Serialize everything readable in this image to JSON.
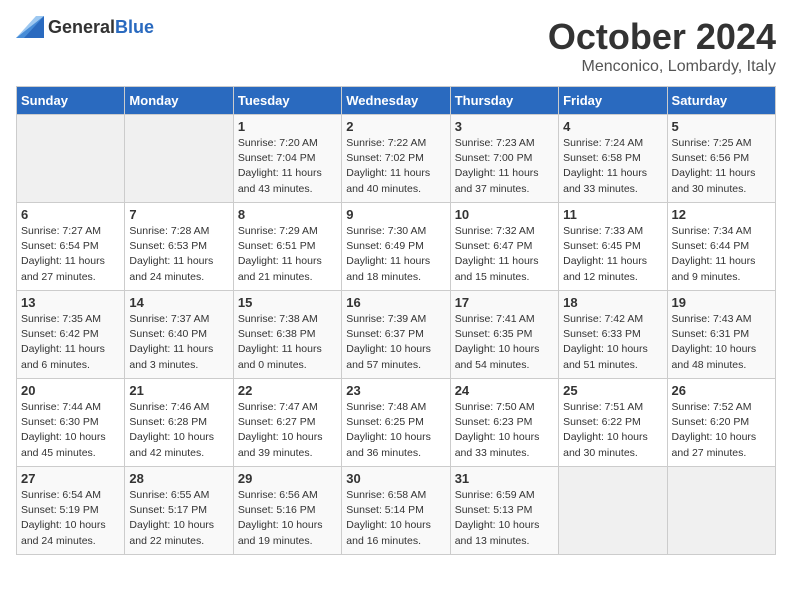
{
  "logo": {
    "general": "General",
    "blue": "Blue"
  },
  "title": "October 2024",
  "subtitle": "Menconico, Lombardy, Italy",
  "headers": [
    "Sunday",
    "Monday",
    "Tuesday",
    "Wednesday",
    "Thursday",
    "Friday",
    "Saturday"
  ],
  "weeks": [
    [
      {
        "day": "",
        "info": ""
      },
      {
        "day": "",
        "info": ""
      },
      {
        "day": "1",
        "info": "Sunrise: 7:20 AM\nSunset: 7:04 PM\nDaylight: 11 hours and 43 minutes."
      },
      {
        "day": "2",
        "info": "Sunrise: 7:22 AM\nSunset: 7:02 PM\nDaylight: 11 hours and 40 minutes."
      },
      {
        "day": "3",
        "info": "Sunrise: 7:23 AM\nSunset: 7:00 PM\nDaylight: 11 hours and 37 minutes."
      },
      {
        "day": "4",
        "info": "Sunrise: 7:24 AM\nSunset: 6:58 PM\nDaylight: 11 hours and 33 minutes."
      },
      {
        "day": "5",
        "info": "Sunrise: 7:25 AM\nSunset: 6:56 PM\nDaylight: 11 hours and 30 minutes."
      }
    ],
    [
      {
        "day": "6",
        "info": "Sunrise: 7:27 AM\nSunset: 6:54 PM\nDaylight: 11 hours and 27 minutes."
      },
      {
        "day": "7",
        "info": "Sunrise: 7:28 AM\nSunset: 6:53 PM\nDaylight: 11 hours and 24 minutes."
      },
      {
        "day": "8",
        "info": "Sunrise: 7:29 AM\nSunset: 6:51 PM\nDaylight: 11 hours and 21 minutes."
      },
      {
        "day": "9",
        "info": "Sunrise: 7:30 AM\nSunset: 6:49 PM\nDaylight: 11 hours and 18 minutes."
      },
      {
        "day": "10",
        "info": "Sunrise: 7:32 AM\nSunset: 6:47 PM\nDaylight: 11 hours and 15 minutes."
      },
      {
        "day": "11",
        "info": "Sunrise: 7:33 AM\nSunset: 6:45 PM\nDaylight: 11 hours and 12 minutes."
      },
      {
        "day": "12",
        "info": "Sunrise: 7:34 AM\nSunset: 6:44 PM\nDaylight: 11 hours and 9 minutes."
      }
    ],
    [
      {
        "day": "13",
        "info": "Sunrise: 7:35 AM\nSunset: 6:42 PM\nDaylight: 11 hours and 6 minutes."
      },
      {
        "day": "14",
        "info": "Sunrise: 7:37 AM\nSunset: 6:40 PM\nDaylight: 11 hours and 3 minutes."
      },
      {
        "day": "15",
        "info": "Sunrise: 7:38 AM\nSunset: 6:38 PM\nDaylight: 11 hours and 0 minutes."
      },
      {
        "day": "16",
        "info": "Sunrise: 7:39 AM\nSunset: 6:37 PM\nDaylight: 10 hours and 57 minutes."
      },
      {
        "day": "17",
        "info": "Sunrise: 7:41 AM\nSunset: 6:35 PM\nDaylight: 10 hours and 54 minutes."
      },
      {
        "day": "18",
        "info": "Sunrise: 7:42 AM\nSunset: 6:33 PM\nDaylight: 10 hours and 51 minutes."
      },
      {
        "day": "19",
        "info": "Sunrise: 7:43 AM\nSunset: 6:31 PM\nDaylight: 10 hours and 48 minutes."
      }
    ],
    [
      {
        "day": "20",
        "info": "Sunrise: 7:44 AM\nSunset: 6:30 PM\nDaylight: 10 hours and 45 minutes."
      },
      {
        "day": "21",
        "info": "Sunrise: 7:46 AM\nSunset: 6:28 PM\nDaylight: 10 hours and 42 minutes."
      },
      {
        "day": "22",
        "info": "Sunrise: 7:47 AM\nSunset: 6:27 PM\nDaylight: 10 hours and 39 minutes."
      },
      {
        "day": "23",
        "info": "Sunrise: 7:48 AM\nSunset: 6:25 PM\nDaylight: 10 hours and 36 minutes."
      },
      {
        "day": "24",
        "info": "Sunrise: 7:50 AM\nSunset: 6:23 PM\nDaylight: 10 hours and 33 minutes."
      },
      {
        "day": "25",
        "info": "Sunrise: 7:51 AM\nSunset: 6:22 PM\nDaylight: 10 hours and 30 minutes."
      },
      {
        "day": "26",
        "info": "Sunrise: 7:52 AM\nSunset: 6:20 PM\nDaylight: 10 hours and 27 minutes."
      }
    ],
    [
      {
        "day": "27",
        "info": "Sunrise: 6:54 AM\nSunset: 5:19 PM\nDaylight: 10 hours and 24 minutes."
      },
      {
        "day": "28",
        "info": "Sunrise: 6:55 AM\nSunset: 5:17 PM\nDaylight: 10 hours and 22 minutes."
      },
      {
        "day": "29",
        "info": "Sunrise: 6:56 AM\nSunset: 5:16 PM\nDaylight: 10 hours and 19 minutes."
      },
      {
        "day": "30",
        "info": "Sunrise: 6:58 AM\nSunset: 5:14 PM\nDaylight: 10 hours and 16 minutes."
      },
      {
        "day": "31",
        "info": "Sunrise: 6:59 AM\nSunset: 5:13 PM\nDaylight: 10 hours and 13 minutes."
      },
      {
        "day": "",
        "info": ""
      },
      {
        "day": "",
        "info": ""
      }
    ]
  ]
}
